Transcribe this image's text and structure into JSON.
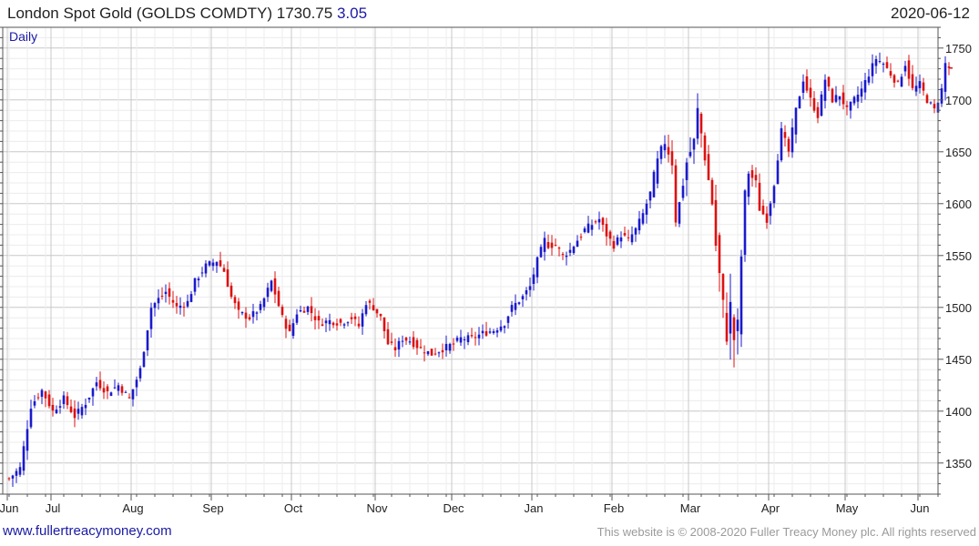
{
  "header": {
    "instrument": "London Spot Gold (GOLDS COMDTY)",
    "last": "1730.75",
    "change": "3.05",
    "date": "2020-06-12",
    "period_label": "Daily"
  },
  "footer": {
    "site": "www.fullertreacymoney.com",
    "copyright": "This website is © 2008-2020 Fuller Treacy Money plc. All rights reserved"
  },
  "colors": {
    "up": "#1a1acc",
    "down": "#dd1111",
    "grid": "#dcdcdc",
    "axis": "#555555"
  },
  "chart_data": {
    "type": "candlestick",
    "title": "London Spot Gold (GOLDS COMDTY)",
    "period": "Daily",
    "ylim": [
      1320,
      1770
    ],
    "yticks": [
      1350,
      1400,
      1450,
      1500,
      1550,
      1600,
      1650,
      1700,
      1750
    ],
    "x_months": [
      "Jun",
      "Jul",
      "Aug",
      "Sep",
      "Oct",
      "Nov",
      "Dec",
      "Jan",
      "Feb",
      "Mar",
      "Apr",
      "May",
      "Jun"
    ],
    "month_starts": [
      0,
      12,
      34,
      56,
      78,
      101,
      122,
      144,
      166,
      187,
      209,
      230,
      250
    ],
    "trend": [
      [
        0,
        1335
      ],
      [
        3,
        1345
      ],
      [
        6,
        1405
      ],
      [
        9,
        1420
      ],
      [
        12,
        1400
      ],
      [
        15,
        1412
      ],
      [
        18,
        1395
      ],
      [
        21,
        1408
      ],
      [
        24,
        1428
      ],
      [
        27,
        1418
      ],
      [
        30,
        1425
      ],
      [
        33,
        1412
      ],
      [
        36,
        1440
      ],
      [
        39,
        1500
      ],
      [
        41,
        1508
      ],
      [
        43,
        1515
      ],
      [
        46,
        1500
      ],
      [
        49,
        1505
      ],
      [
        51,
        1525
      ],
      [
        54,
        1540
      ],
      [
        57,
        1545
      ],
      [
        59,
        1535
      ],
      [
        61,
        1510
      ],
      [
        63,
        1495
      ],
      [
        66,
        1490
      ],
      [
        69,
        1500
      ],
      [
        72,
        1525
      ],
      [
        75,
        1490
      ],
      [
        77,
        1475
      ],
      [
        79,
        1495
      ],
      [
        82,
        1500
      ],
      [
        85,
        1485
      ],
      [
        88,
        1487
      ],
      [
        91,
        1485
      ],
      [
        94,
        1490
      ],
      [
        96,
        1482
      ],
      [
        98,
        1505
      ],
      [
        100,
        1500
      ],
      [
        102,
        1490
      ],
      [
        104,
        1465
      ],
      [
        106,
        1460
      ],
      [
        108,
        1470
      ],
      [
        110,
        1468
      ],
      [
        113,
        1460
      ],
      [
        116,
        1455
      ],
      [
        119,
        1460
      ],
      [
        122,
        1465
      ],
      [
        124,
        1470
      ],
      [
        127,
        1470
      ],
      [
        130,
        1475
      ],
      [
        133,
        1478
      ],
      [
        136,
        1485
      ],
      [
        138,
        1500
      ],
      [
        141,
        1510
      ],
      [
        143,
        1520
      ],
      [
        145,
        1545
      ],
      [
        147,
        1565
      ],
      [
        148,
        1560
      ],
      [
        150,
        1560
      ],
      [
        152,
        1550
      ],
      [
        154,
        1555
      ],
      [
        156,
        1565
      ],
      [
        158,
        1575
      ],
      [
        160,
        1580
      ],
      [
        162,
        1585
      ],
      [
        164,
        1570
      ],
      [
        166,
        1560
      ],
      [
        168,
        1570
      ],
      [
        170,
        1565
      ],
      [
        172,
        1575
      ],
      [
        174,
        1590
      ],
      [
        176,
        1610
      ],
      [
        178,
        1640
      ],
      [
        180,
        1660
      ],
      [
        182,
        1640
      ],
      [
        183,
        1585
      ],
      [
        184,
        1600
      ],
      [
        186,
        1640
      ],
      [
        188,
        1660
      ],
      [
        189,
        1690
      ],
      [
        191,
        1645
      ],
      [
        193,
        1600
      ],
      [
        194,
        1560
      ],
      [
        195,
        1530
      ],
      [
        196,
        1500
      ],
      [
        197,
        1475
      ],
      [
        198,
        1500
      ],
      [
        199,
        1470
      ],
      [
        200,
        1480
      ],
      [
        201,
        1550
      ],
      [
        202,
        1610
      ],
      [
        203,
        1630
      ],
      [
        205,
        1620
      ],
      [
        206,
        1595
      ],
      [
        208,
        1585
      ],
      [
        210,
        1620
      ],
      [
        212,
        1670
      ],
      [
        214,
        1650
      ],
      [
        216,
        1690
      ],
      [
        218,
        1720
      ],
      [
        220,
        1700
      ],
      [
        222,
        1685
      ],
      [
        224,
        1720
      ],
      [
        226,
        1700
      ],
      [
        228,
        1705
      ],
      [
        230,
        1690
      ],
      [
        232,
        1700
      ],
      [
        234,
        1710
      ],
      [
        236,
        1725
      ],
      [
        238,
        1740
      ],
      [
        240,
        1735
      ],
      [
        242,
        1725
      ],
      [
        244,
        1715
      ],
      [
        246,
        1735
      ],
      [
        248,
        1710
      ],
      [
        250,
        1715
      ],
      [
        252,
        1700
      ],
      [
        254,
        1690
      ],
      [
        256,
        1710
      ],
      [
        257,
        1735
      ],
      [
        258,
        1731
      ]
    ]
  }
}
